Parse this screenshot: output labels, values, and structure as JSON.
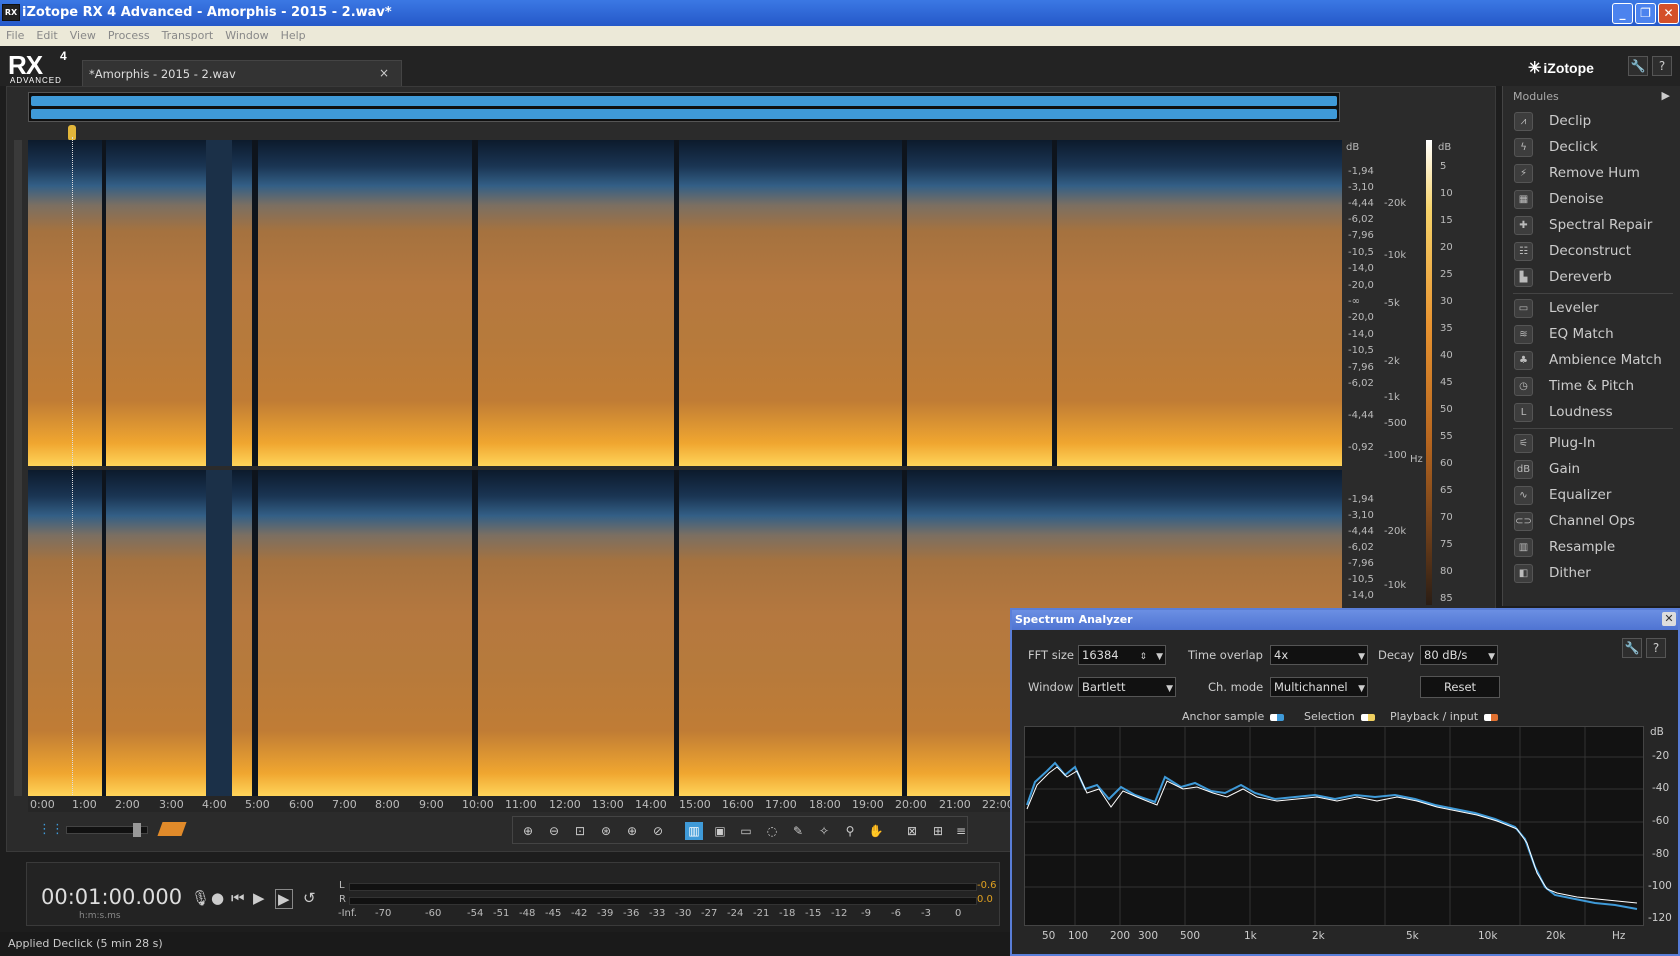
{
  "window": {
    "title": "iZotope RX 4 Advanced - Amorphis - 2015 - 2.wav*",
    "app_icon": "RX"
  },
  "menu": [
    "File",
    "Edit",
    "View",
    "Process",
    "Transport",
    "Window",
    "Help"
  ],
  "logo": {
    "main": "RX",
    "version": "4",
    "edition": "ADVANCED"
  },
  "file_tab": {
    "name": "*Amorphis - 2015 - 2.wav",
    "close": "×"
  },
  "brand": "iZotope",
  "db_scale_left": [
    "dB",
    "-1,94",
    "-3,10",
    "-4,44",
    "-6,02",
    "-7,96",
    "-10,5",
    "-14,0",
    "-20,0",
    "-∞",
    "-20,0",
    "-14,0",
    "-10,5",
    "-7,96",
    "-6,02",
    "-4,44",
    "-3,10",
    "-1,94",
    "-0,92"
  ],
  "db_scale_left_b": [
    "-1,94",
    "-3,10",
    "-4,44",
    "-6,02",
    "-7,96",
    "-10,5",
    "-14,0"
  ],
  "freq_scale": [
    "-20k",
    "-10k",
    "-5k",
    "-2k",
    "-1k",
    "-500",
    "-100"
  ],
  "freq_scale_unit": "Hz",
  "freq_scale_b": [
    "-20k",
    "-10k"
  ],
  "color_scale": [
    "dB",
    "5",
    "10",
    "15",
    "20",
    "25",
    "30",
    "35",
    "40",
    "45",
    "50",
    "55",
    "60",
    "65",
    "70",
    "75",
    "80",
    "85"
  ],
  "timeline": [
    "0:00",
    "1:00",
    "2:00",
    "3:00",
    "4:00",
    "5:00",
    "6:00",
    "7:00",
    "8:00",
    "9:00",
    "10:00",
    "11:00",
    "12:00",
    "13:00",
    "14:00",
    "15:00",
    "16:00",
    "17:00",
    "18:00",
    "19:00",
    "20:00",
    "21:00",
    "22:00"
  ],
  "transport": {
    "time": "00:01:00.000",
    "time_format": "h:m:s.ms",
    "meter_l_label": "L",
    "meter_r_label": "R",
    "peak_l": "-0.6",
    "peak_r": "0.0",
    "meter_scale": [
      "-Inf.",
      "-70",
      "-60",
      "-54",
      "-51",
      "-48",
      "-45",
      "-42",
      "-39",
      "-36",
      "-33",
      "-30",
      "-27",
      "-24",
      "-21",
      "-18",
      "-15",
      "-12",
      "-9",
      "-6",
      "-3",
      "0"
    ]
  },
  "status": "Applied Declick (5 min 28 s)",
  "modules": {
    "header": "Modules",
    "items": [
      {
        "label": "Declip",
        "icon": "declip-icon"
      },
      {
        "label": "Declick",
        "icon": "declick-icon"
      },
      {
        "label": "Remove Hum",
        "icon": "remove-hum-icon"
      },
      {
        "label": "Denoise",
        "icon": "denoise-icon"
      },
      {
        "label": "Spectral Repair",
        "icon": "spectral-repair-icon"
      },
      {
        "label": "Deconstruct",
        "icon": "deconstruct-icon"
      },
      {
        "label": "Dereverb",
        "icon": "dereverb-icon"
      },
      {
        "label": "Leveler",
        "icon": "leveler-icon"
      },
      {
        "label": "EQ Match",
        "icon": "eq-match-icon"
      },
      {
        "label": "Ambience Match",
        "icon": "ambience-match-icon"
      },
      {
        "label": "Time & Pitch",
        "icon": "time-pitch-icon"
      },
      {
        "label": "Loudness",
        "icon": "loudness-icon"
      },
      {
        "label": "Plug-In",
        "icon": "plug-in-icon"
      },
      {
        "label": "Gain",
        "icon": "gain-icon"
      },
      {
        "label": "Equalizer",
        "icon": "equalizer-icon"
      },
      {
        "label": "Channel Ops",
        "icon": "channel-ops-icon"
      },
      {
        "label": "Resample",
        "icon": "resample-icon"
      },
      {
        "label": "Dither",
        "icon": "dither-icon"
      }
    ]
  },
  "spectrum_analyzer": {
    "title": "Spectrum Analyzer",
    "fft_label": "FFT size",
    "fft_value": "16384",
    "overlap_label": "Time overlap",
    "overlap_value": "4x",
    "decay_label": "Decay",
    "decay_value": "80 dB/s",
    "window_label": "Window",
    "window_value": "Bartlett",
    "chmode_label": "Ch. mode",
    "chmode_value": "Multichannel",
    "reset_label": "Reset",
    "legend": {
      "anchor": "Anchor sample",
      "selection": "Selection",
      "playback": "Playback / input"
    },
    "y_ticks": [
      "dB",
      "-20",
      "-40",
      "-60",
      "-80",
      "-100",
      "-120"
    ],
    "x_ticks": [
      "50",
      "100",
      "200",
      "300",
      "500",
      "1k",
      "2k",
      "5k",
      "10k",
      "20k",
      "Hz"
    ]
  },
  "colors": {
    "accent": "#3f9ad8",
    "spectrogram_low": "#ffd45a",
    "spectrogram_mid": "#b5783f",
    "spectrogram_high": "#1a3553",
    "selection_chip": "#f0d060",
    "playback_chip": "#e07030"
  }
}
